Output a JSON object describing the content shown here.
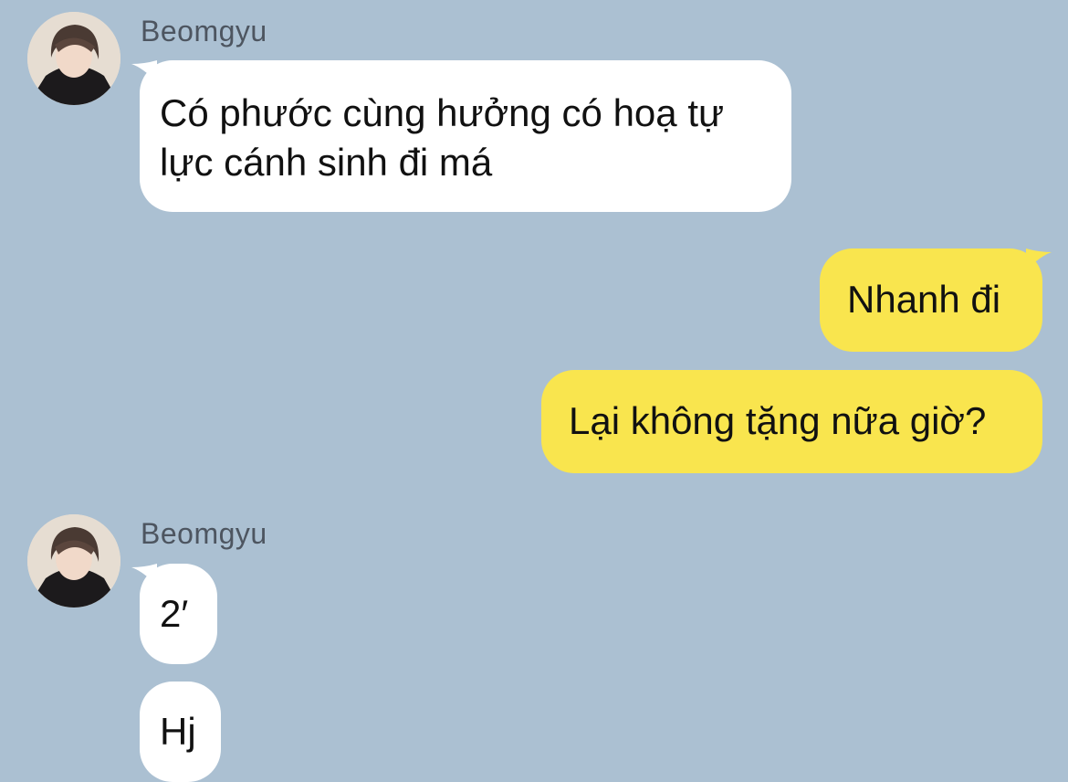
{
  "colors": {
    "background": "#abc0d2",
    "incoming_bubble": "#ffffff",
    "outgoing_bubble": "#f9e54e",
    "sender_name": "#4d5560"
  },
  "messages": [
    {
      "id": "m1",
      "direction": "incoming",
      "sender": "Beomgyu",
      "lines": [
        "Có phước cùng hưởng có hoạ tự",
        "lực cánh sinh đi má"
      ]
    },
    {
      "id": "m2",
      "direction": "outgoing",
      "text": "Nhanh đi"
    },
    {
      "id": "m3",
      "direction": "outgoing",
      "text": "Lại không tặng nữa giờ?"
    },
    {
      "id": "m4",
      "direction": "incoming",
      "sender": "Beomgyu",
      "text": "2′"
    },
    {
      "id": "m5",
      "direction": "incoming",
      "text": "Hj"
    }
  ]
}
